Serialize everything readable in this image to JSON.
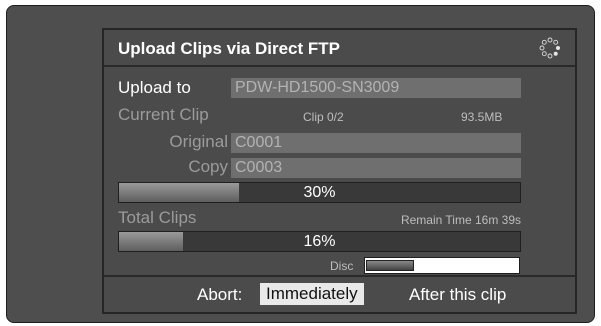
{
  "dialog": {
    "title": "Upload Clips via Direct FTP",
    "upload_to_label": "Upload to",
    "upload_to_value": "PDW-HD1500-SN3009",
    "current_clip_label": "Current Clip",
    "clip_count": "Clip 0/2",
    "clip_size": "93.5MB",
    "original_label": "Original",
    "original_value": "C0001",
    "copy_label": "Copy",
    "copy_value": "C0003",
    "clip_progress_text": "30%",
    "clip_progress_fraction": 0.3,
    "total_clips_label": "Total Clips",
    "remain_time": "Remain Time 16m 39s",
    "total_progress_text": "16%",
    "total_progress_fraction": 0.16,
    "disc_label": "Disc",
    "disc_used_fraction": 0.31
  },
  "footer": {
    "abort_label": "Abort:",
    "immediately_label": "Immediately",
    "after_clip_label": "After this clip"
  },
  "icons": {
    "busy": "busy-spinner-icon"
  }
}
